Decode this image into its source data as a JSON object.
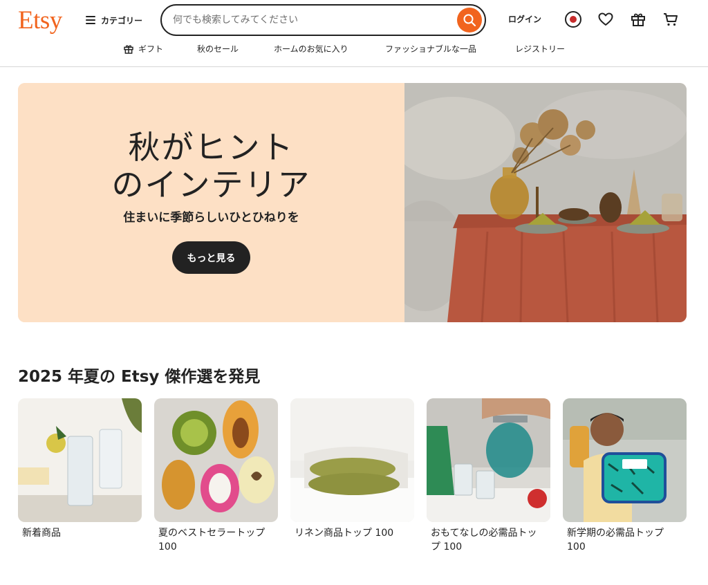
{
  "header": {
    "logo": "Etsy",
    "categories_label": "カテゴリー",
    "search_placeholder": "何でも検索してみてください",
    "login_label": "ログイン"
  },
  "nav": [
    {
      "label": "ギフト"
    },
    {
      "label": "秋のセール"
    },
    {
      "label": "ホームのお気に入り"
    },
    {
      "label": "ファッショナブルな一品"
    },
    {
      "label": "レジストリー"
    }
  ],
  "hero": {
    "title_line1": "秋がヒント",
    "title_line2": "のインテリア",
    "subtitle": "住まいに季節らしいひとひねりを",
    "button_label": "もっと見る"
  },
  "section": {
    "title": "2025 年夏の Etsy 傑作選を発見",
    "cards": [
      {
        "label": "新着商品"
      },
      {
        "label": "夏のベストセラートップ 100"
      },
      {
        "label": "リネン商品トップ 100"
      },
      {
        "label": "おもてなしの必需品トップ 100"
      },
      {
        "label": "新学期の必需品トップ 100"
      }
    ]
  },
  "colors": {
    "brand": "#f1641e",
    "hero_bg": "#fde0c5",
    "button_dark": "#222222"
  }
}
